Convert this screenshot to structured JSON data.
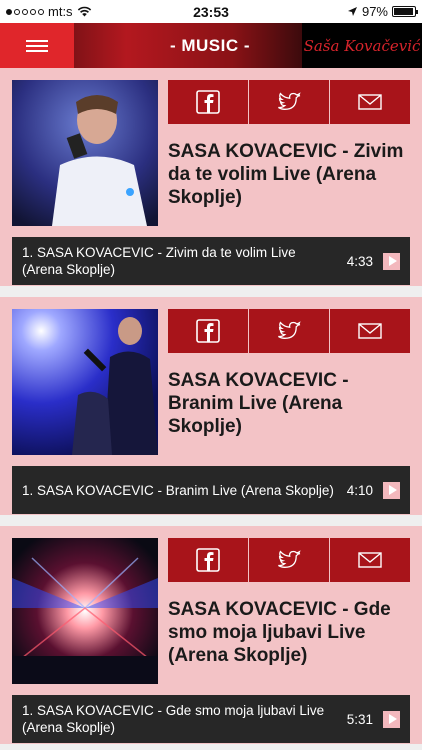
{
  "status_bar": {
    "carrier": "mt:s",
    "time": "23:53",
    "battery": "97%",
    "battery_level": 0.97
  },
  "header": {
    "title": "- MUSIC -",
    "brand": "Saša Kovačević",
    "colors": {
      "accent": "#e0262b",
      "dark": "#1b1b1b"
    }
  },
  "cards": [
    {
      "title": "SASA KOVACEVIC - Zivim da te volim Live (Arena Skoplje)",
      "track": "1. SASA KOVACEVIC - Zivim da te volim Live (Arena Skoplje)",
      "duration": "4:33"
    },
    {
      "title": "SASA KOVACEVIC - Branim Live (Arena Skoplje)",
      "track": "1. SASA KOVACEVIC - Branim Live (Arena Skoplje)",
      "duration": "4:10"
    },
    {
      "title": "SASA KOVACEVIC - Gde smo moja ljubavi Live (Arena Skoplje)",
      "track": "1. SASA KOVACEVIC - Gde smo moja ljubavi Live (Arena Skoplje)",
      "duration": "5:31"
    }
  ],
  "share_icons": [
    "facebook-icon",
    "twitter-icon",
    "mail-icon"
  ],
  "colors": {
    "card_bg": "#f3c3c6",
    "share_bg": "#a8141a",
    "track_bg": "#272727",
    "play_bg": "#f3b8bd"
  }
}
